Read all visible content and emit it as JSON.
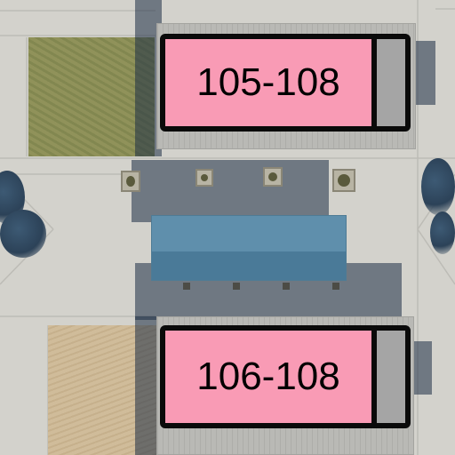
{
  "map": {
    "type": "aerial",
    "labels": [
      {
        "text": "105-108",
        "fill": "#f99bb5",
        "cap_fill": "#a5a5a5",
        "border": "#0a0a0a"
      },
      {
        "text": "106-108",
        "fill": "#f99bb5",
        "cap_fill": "#a5a5a5",
        "border": "#0a0a0a"
      }
    ]
  }
}
